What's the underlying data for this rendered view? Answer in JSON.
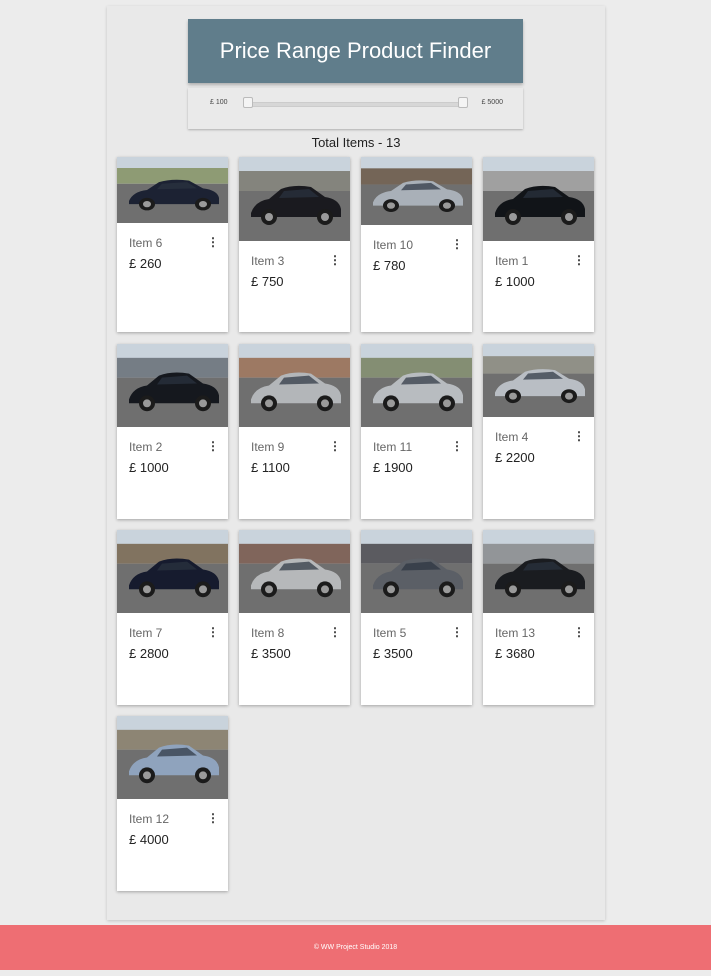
{
  "header": {
    "title": "Price Range Product Finder"
  },
  "slider": {
    "min_label": "£ 100",
    "max_label": "£ 5000",
    "min_value": 100,
    "max_value": 5000
  },
  "summary": {
    "total_label": "Total Items - 13"
  },
  "colors": {
    "header_bg": "#607d8b",
    "footer_bg": "#ee6e73",
    "page_bg": "#ececec"
  },
  "products": [
    {
      "title": "Item 6",
      "price": "£ 260",
      "menu_icon": "more-vert-icon",
      "car_color": "#1c2233",
      "bg": "#7a8a5c"
    },
    {
      "title": "Item 3",
      "price": "£ 750",
      "menu_icon": "more-vert-icon",
      "car_color": "#1a1a1f",
      "bg": "#6e6e66"
    },
    {
      "title": "Item 10",
      "price": "£ 780",
      "menu_icon": "more-vert-icon",
      "car_color": "#a9b0b8",
      "bg": "#5c4a3a"
    },
    {
      "title": "Item 1",
      "price": "£ 1000",
      "menu_icon": "more-vert-icon",
      "car_color": "#111418",
      "bg": "#8f8f8f"
    },
    {
      "title": "Item 2",
      "price": "£ 1000",
      "menu_icon": "more-vert-icon",
      "car_color": "#15181e",
      "bg": "#5d6670"
    },
    {
      "title": "Item 9",
      "price": "£ 1100",
      "menu_icon": "more-vert-icon",
      "car_color": "#b3b6b9",
      "bg": "#8c6248"
    },
    {
      "title": "Item 11",
      "price": "£ 1900",
      "menu_icon": "more-vert-icon",
      "car_color": "#b8bcc0",
      "bg": "#6f7a5b"
    },
    {
      "title": "Item 4",
      "price": "£ 2200",
      "menu_icon": "more-vert-icon",
      "car_color": "#b9bec4",
      "bg": "#7d7d72"
    },
    {
      "title": "Item 7",
      "price": "£ 2800",
      "menu_icon": "more-vert-icon",
      "car_color": "#161b2e",
      "bg": "#6b5a44"
    },
    {
      "title": "Item 8",
      "price": "£ 3500",
      "menu_icon": "more-vert-icon",
      "car_color": "#b6b8ba",
      "bg": "#6a4a3e"
    },
    {
      "title": "Item 5",
      "price": "£ 3500",
      "menu_icon": "more-vert-icon",
      "car_color": "#5b5f66",
      "bg": "#3e3e44"
    },
    {
      "title": "Item 13",
      "price": "£ 3680",
      "menu_icon": "more-vert-icon",
      "car_color": "#1a1c20",
      "bg": "#7f8386"
    },
    {
      "title": "Item 12",
      "price": "£ 4000",
      "menu_icon": "more-vert-icon",
      "car_color": "#8fa3bd",
      "bg": "#79705c"
    }
  ],
  "footer": {
    "text": "© WW Project Studio 2018"
  }
}
